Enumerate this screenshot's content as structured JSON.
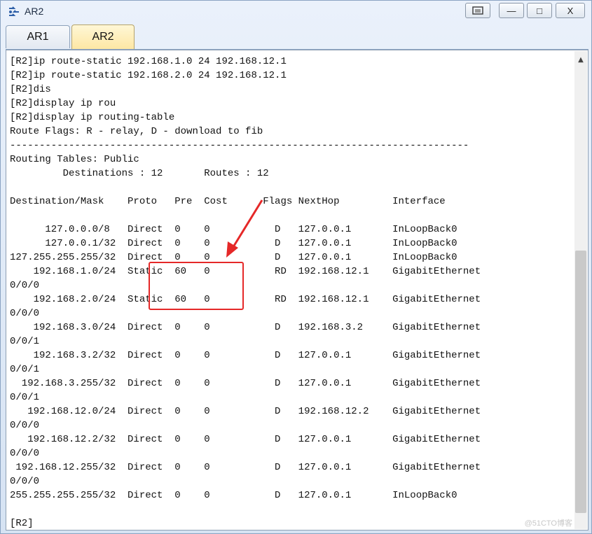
{
  "window": {
    "title": "AR2",
    "controls": {
      "restore": "▣",
      "minimize": "—",
      "maximize": "□",
      "close": "X"
    }
  },
  "tabs": [
    {
      "label": "AR1",
      "active": false
    },
    {
      "label": "AR2",
      "active": true
    }
  ],
  "terminal": {
    "lines": [
      "[R2]ip route-static 192.168.1.0 24 192.168.12.1",
      "[R2]ip route-static 192.168.2.0 24 192.168.12.1",
      "[R2]dis",
      "[R2]display ip rou",
      "[R2]display ip routing-table",
      "Route Flags: R - relay, D - download to fib",
      "------------------------------------------------------------------------------",
      "Routing Tables: Public",
      "         Destinations : 12       Routes : 12",
      "",
      "Destination/Mask    Proto   Pre  Cost      Flags NextHop         Interface",
      "",
      "      127.0.0.0/8   Direct  0    0           D   127.0.0.1       InLoopBack0",
      "      127.0.0.1/32  Direct  0    0           D   127.0.0.1       InLoopBack0",
      "127.255.255.255/32  Direct  0    0           D   127.0.0.1       InLoopBack0",
      "    192.168.1.0/24  Static  60   0           RD  192.168.12.1    GigabitEthernet",
      "0/0/0",
      "    192.168.2.0/24  Static  60   0           RD  192.168.12.1    GigabitEthernet",
      "0/0/0",
      "    192.168.3.0/24  Direct  0    0           D   192.168.3.2     GigabitEthernet",
      "0/0/1",
      "    192.168.3.2/32  Direct  0    0           D   127.0.0.1       GigabitEthernet",
      "0/0/1",
      "  192.168.3.255/32  Direct  0    0           D   127.0.0.1       GigabitEthernet",
      "0/0/1",
      "   192.168.12.0/24  Direct  0    0           D   192.168.12.2    GigabitEthernet",
      "0/0/0",
      "   192.168.12.2/32  Direct  0    0           D   127.0.0.1       GigabitEthernet",
      "0/0/0",
      " 192.168.12.255/32  Direct  0    0           D   127.0.0.1       GigabitEthernet",
      "0/0/0",
      "255.255.255.255/32  Direct  0    0           D   127.0.0.1       InLoopBack0",
      "",
      "[R2]"
    ]
  },
  "annotation": {
    "color": "#e52828"
  },
  "watermark": "@51CTO博客"
}
